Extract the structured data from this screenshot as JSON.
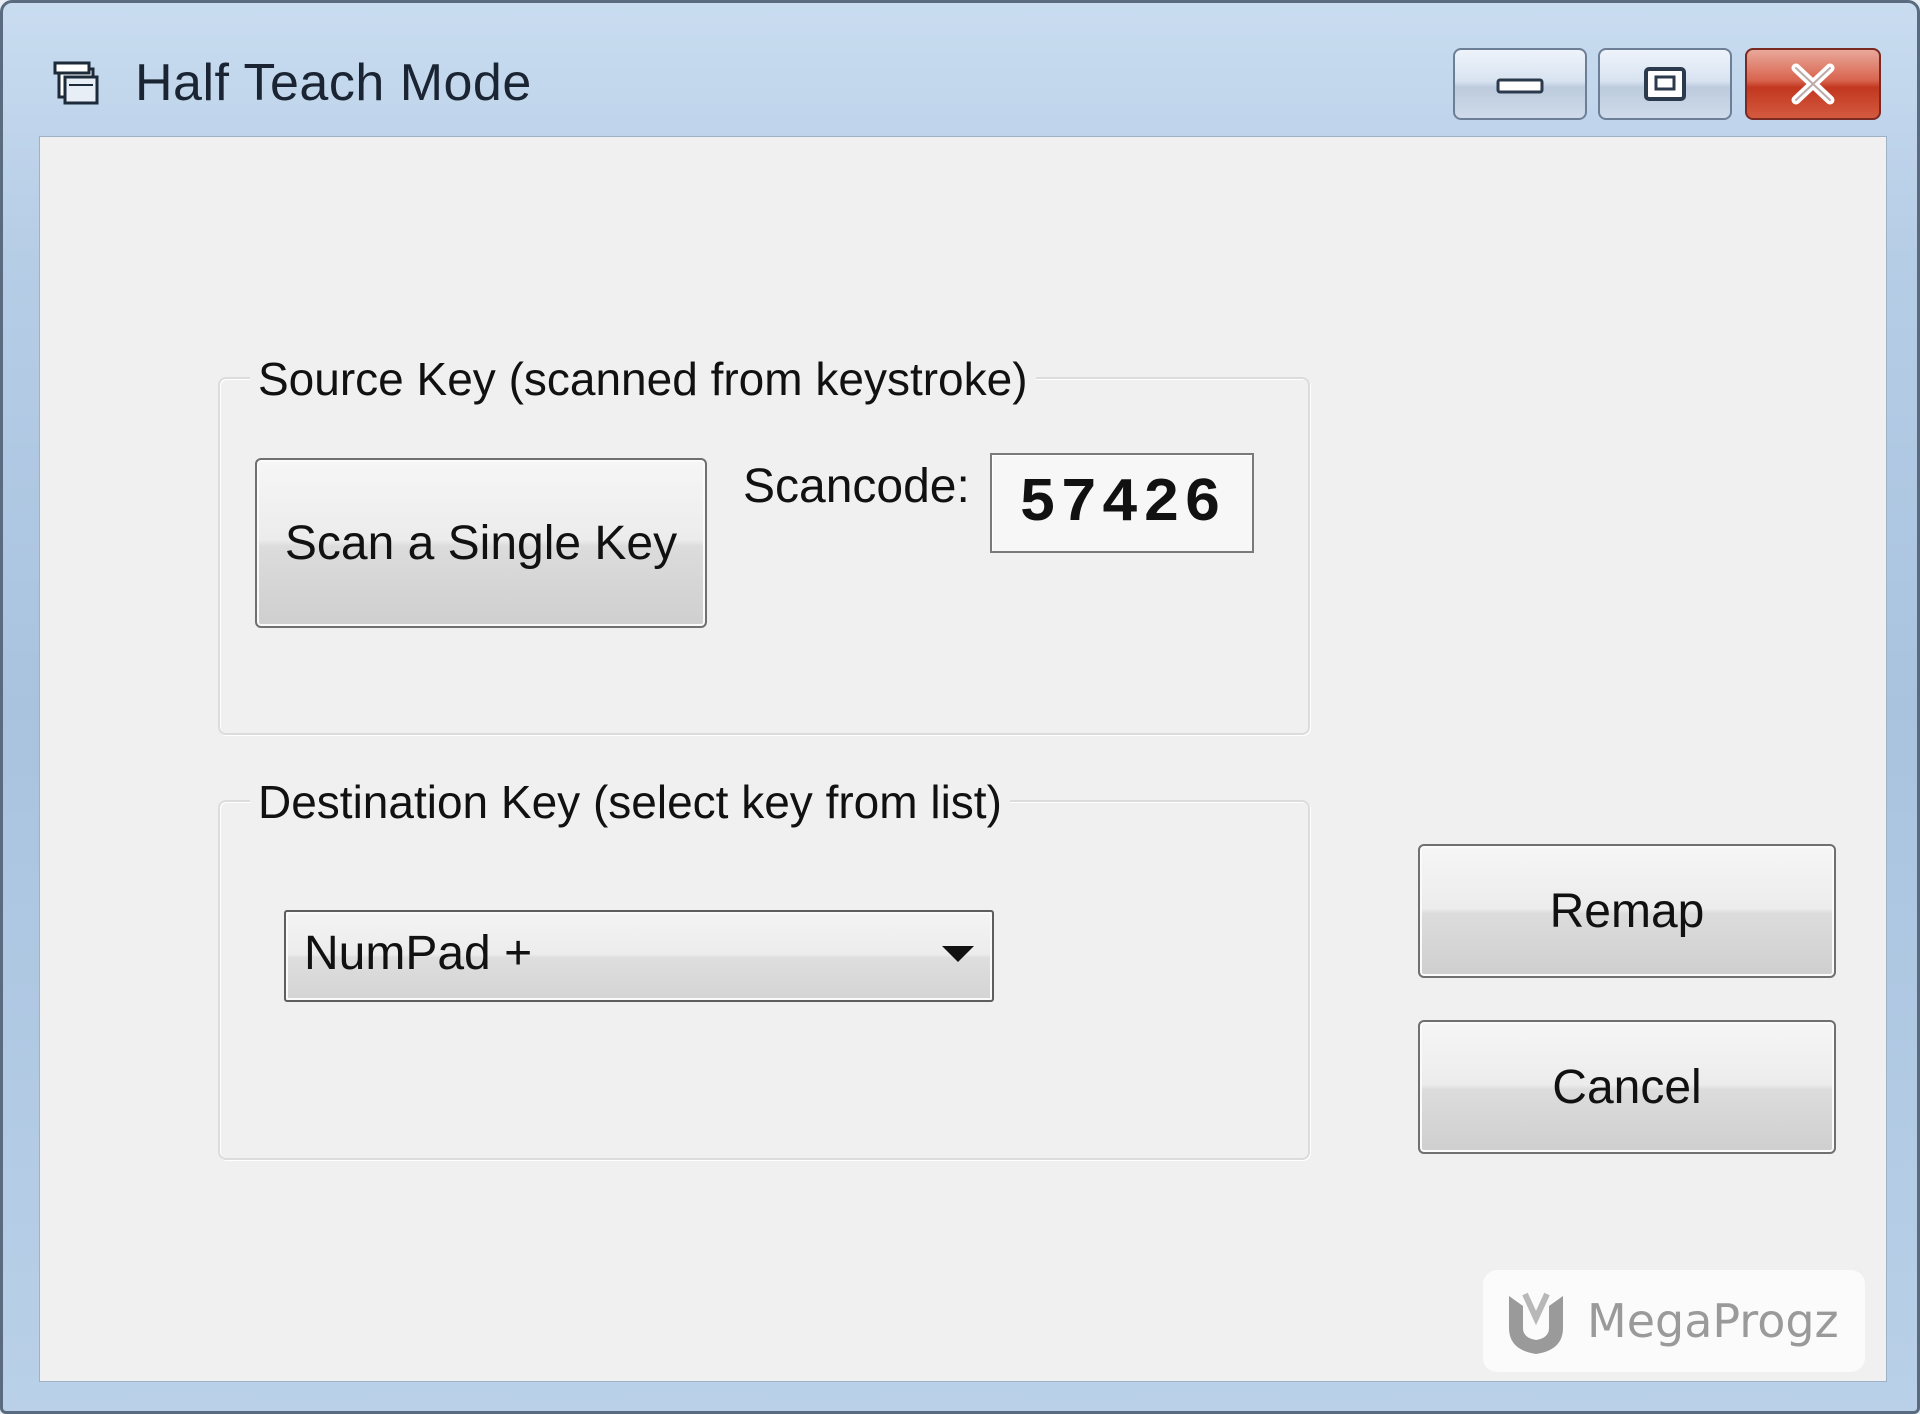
{
  "window": {
    "title": "Half Teach Mode",
    "icon": "app-window-icon",
    "controls": {
      "minimize_icon": "minimize-icon",
      "maximize_icon": "maximize-icon",
      "close_icon": "close-icon"
    }
  },
  "source_group": {
    "legend": "Source Key (scanned from keystroke)",
    "scan_button_label": "Scan a Single Key",
    "scancode_label": "Scancode:",
    "scancode_value": "57426"
  },
  "destination_group": {
    "legend": "Destination Key (select key from list)",
    "selected_key": "NumPad +"
  },
  "actions": {
    "remap_label": "Remap",
    "cancel_label": "Cancel"
  },
  "watermark": {
    "text": "MegaProgz"
  },
  "colors": {
    "close_button": "#c2371f",
    "client_background": "#f0f0f0",
    "title_gradient": "#b6cde6"
  }
}
